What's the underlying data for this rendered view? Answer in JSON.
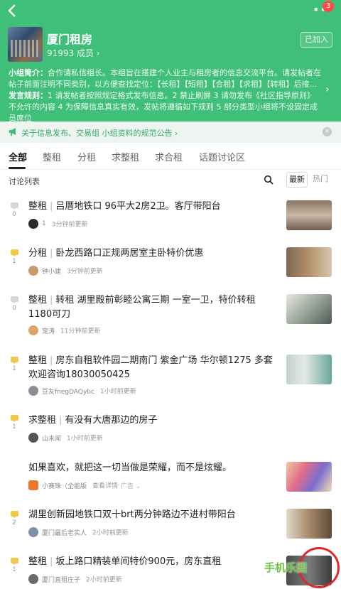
{
  "nav": {
    "back_icon": "back-chevron-icon",
    "more_icon": "more-dots-icon",
    "badge": "3"
  },
  "group": {
    "name": "厦门租房",
    "members": "91993 成员 ›",
    "join_state": "已加入",
    "intro_label": "小组简介：",
    "intro_text": "合作请私信组长。本组旨在搭建个人业主与租房者的信息交流平台。请发帖者在帖子前面注明不同类别，以方便查找定位：【长租】【短租】【合租】【求租】【转租】后接...",
    "rules_label": "发言规则：",
    "rules_text": "1 请发帖者按照规定格式发布信息。2 禁止刷屏 3 请勿发布《社区指导原则》不允许的内容 4 为保障信息真实有效，发帖将遵循如下规则 5 部分类型小组将不设固定成员席位"
  },
  "notice": {
    "text": "关于信息发布、交易组 小组资料的规范公告 ›"
  },
  "tabs": [
    "全部",
    "整租",
    "分租",
    "求整租",
    "求合租",
    "话题讨论区"
  ],
  "list": {
    "title": "讨论列表",
    "sort_new": "最新",
    "sort_hot": "热门"
  },
  "posts": [
    {
      "category": "整租",
      "title": "吕厝地铁口 96平大2房2卫。客厅带阳台",
      "votes": "0",
      "author": "1",
      "time": "3分钟前更新"
    },
    {
      "category": "分租",
      "title": "卧龙西路口正规两居室主卧特价优惠",
      "votes": "1",
      "author": "钟小建",
      "time": "3分钟前更新"
    },
    {
      "category": "整租",
      "title": "转租 湖里殿前彰睦公寓三期 一室一卫，特价转租1180可刀",
      "votes": "0",
      "author": "宠涛",
      "time": "11分钟前更新"
    },
    {
      "category": "整租",
      "title": "房东自租软件园二期南门 紫金广场 华尔顿1275 多套 欢迎咨询18030050425",
      "votes": "1",
      "author": "豆友fnegDAQybc",
      "time": "1小时前更新"
    },
    {
      "category": "求整租",
      "title": "有没有大唐那边的房子",
      "votes": "1",
      "author": "山未闻",
      "time": "1小时前更新"
    },
    {
      "title": "如果喜欢，就把这一切当做是荣耀，而不是炫耀。",
      "author": "小赛珠（全能版",
      "time": "查看详情",
      "ad": "广告 ⌄"
    },
    {
      "title": "湖里创新园地铁口双十brt两分钟路边不进村带阳台",
      "votes": "2",
      "author": "厦门最后老实人",
      "time": "2小时前更新"
    },
    {
      "category": "整租",
      "title": "坂上路口精装单间特价900元，房东直租",
      "votes": "1",
      "author": "厦门直租庄子",
      "time": "2小时前更新"
    }
  ],
  "watermark": "手机乐园",
  "colors": {
    "brand_green": "#3fbf78",
    "notice_bg": "#eef5f0",
    "vote_yellow": "#f1c84b"
  }
}
